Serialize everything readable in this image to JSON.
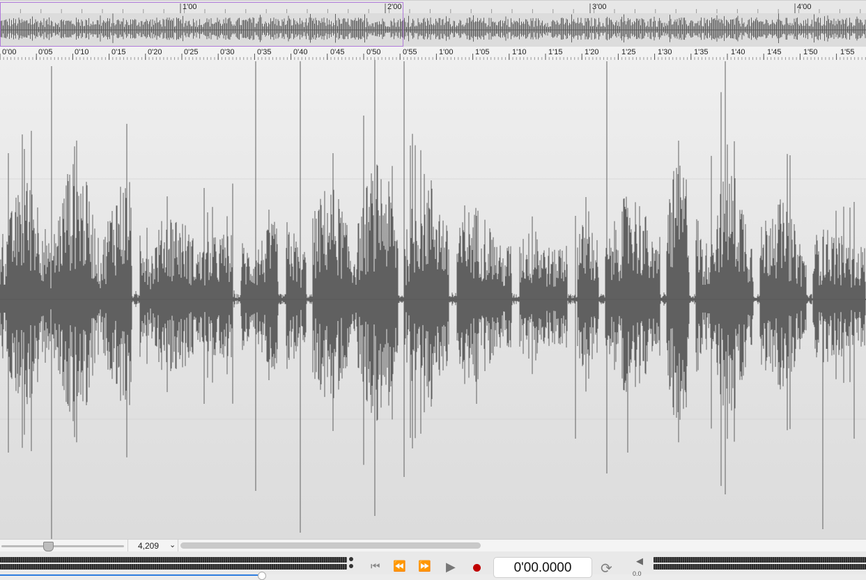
{
  "overview": {
    "labels": [
      "1'00",
      "2'00",
      "3'00",
      "4'00"
    ]
  },
  "ruler": {
    "labels": [
      "0'00",
      "0'05",
      "0'10",
      "0'15",
      "0'20",
      "0'25",
      "0'30",
      "0'35",
      "0'40",
      "0'45",
      "0'50",
      "0'55",
      "1'00",
      "1'05",
      "1'10",
      "1'15",
      "1'20",
      "1'25",
      "1'30",
      "1'35",
      "1'40",
      "1'45",
      "1'50",
      "1'55"
    ]
  },
  "zoom": {
    "value": "4,209"
  },
  "transport": {
    "time": "0'00.0000",
    "volume": "0.0"
  },
  "colors": {
    "waveform": "#606060",
    "selection": "#b07ad9",
    "record": "#c00000"
  },
  "icons": {
    "skip_back": "skip-to-start-icon",
    "rewind": "rewind-icon",
    "forward": "fast-forward-icon",
    "play": "play-icon",
    "record": "record-icon",
    "loop": "loop-icon",
    "speaker": "speaker-icon"
  }
}
